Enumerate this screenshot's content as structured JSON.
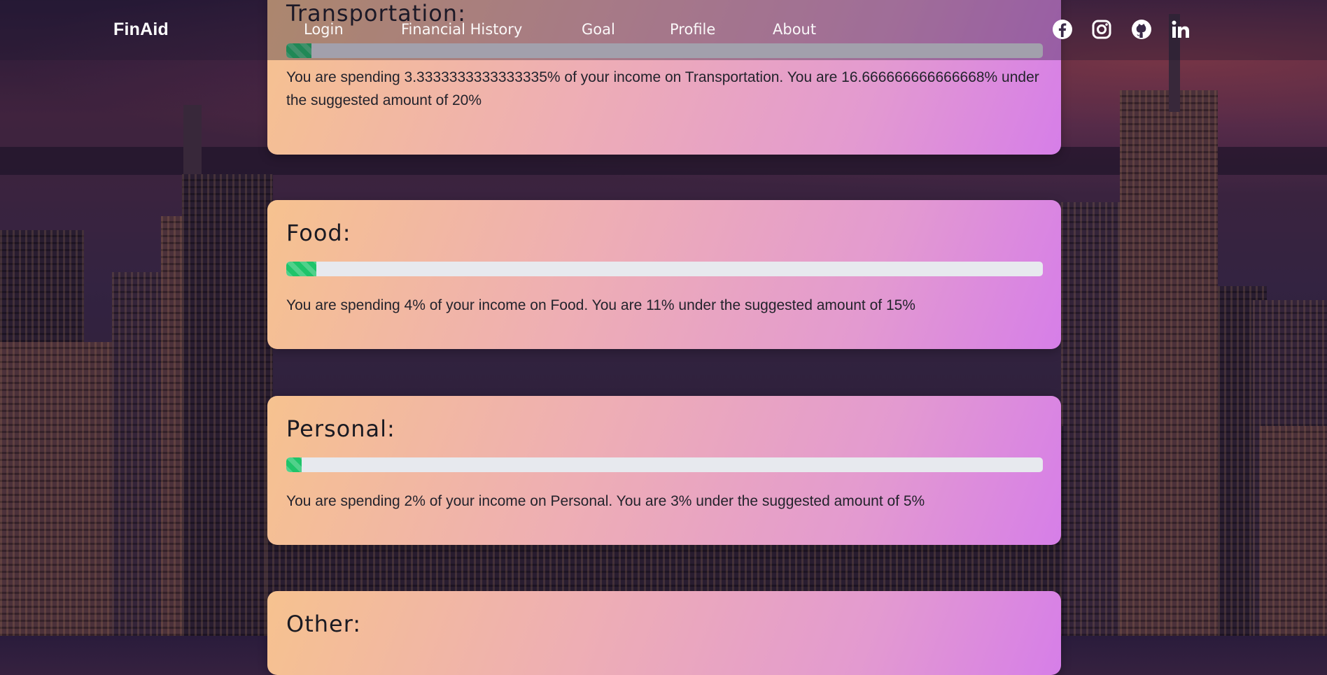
{
  "brand": "FinAid",
  "nav": {
    "links": [
      "Login",
      "Financial History",
      "Goal",
      "Profile",
      "About"
    ],
    "social_icons": [
      "facebook-icon",
      "instagram-icon",
      "github-icon",
      "linkedin-icon"
    ]
  },
  "colors": {
    "progress_fill": "#1fc46a",
    "progress_track": "#e7e9ee",
    "card_gradient_start": "#f6c28f",
    "card_gradient_end": "#d67ee8",
    "nav_text": "#ffffff"
  },
  "categories": [
    {
      "title": "Transportation:",
      "percent": 3.3333333333333335,
      "message": "You are spending 3.3333333333333335% of your income on Transportation. You are 16.666666666666668% under the suggested amount of 20%"
    },
    {
      "title": "Food:",
      "percent": 4,
      "message": "You are spending 4% of your income on Food. You are 11% under the suggested amount of 15%"
    },
    {
      "title": "Personal:",
      "percent": 2,
      "message": "You are spending 2% of your income on Personal. You are 3% under the suggested amount of 5%"
    },
    {
      "title": "Other:"
    }
  ]
}
